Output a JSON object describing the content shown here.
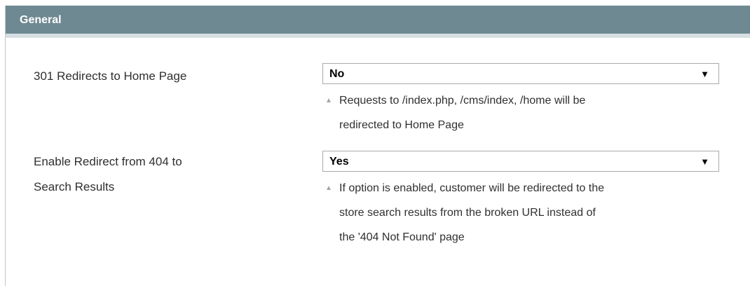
{
  "section": {
    "title": "General"
  },
  "fields": [
    {
      "label": "301 Redirects to Home Page",
      "value": "No",
      "note_lines": [
        "Requests to /index.php, /cms/index, /home will be",
        "redirected to Home Page"
      ]
    },
    {
      "label_lines": [
        "Enable Redirect from 404 to",
        "Search Results"
      ],
      "value": "Yes",
      "note_lines": [
        "If option is enabled, customer will be redirected to the",
        "store search results from the broken URL instead of",
        "the '404 Not Found' page"
      ]
    }
  ],
  "icons": {
    "dropdown": "triangle-down",
    "note": "triangle-up"
  },
  "colors": {
    "header_bg": "#6f8992",
    "header_text": "#ffffff",
    "header_border": "#d7dfe2"
  }
}
